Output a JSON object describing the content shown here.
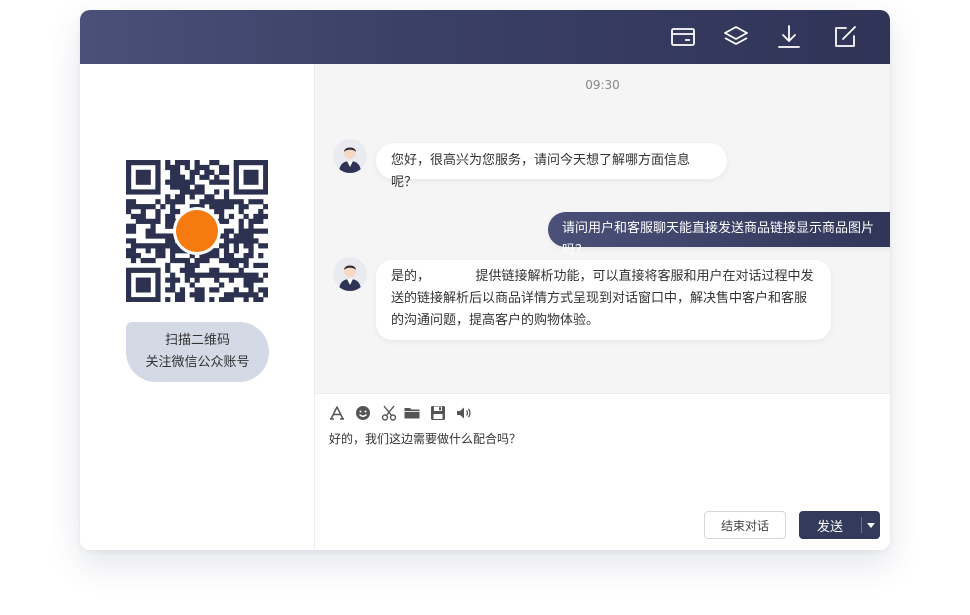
{
  "titlebar": {
    "icons": [
      "card-icon",
      "layers-icon",
      "download-icon",
      "edit-icon"
    ]
  },
  "left_panel": {
    "qr_caption_line1": "扫描二维码",
    "qr_caption_line2": "关注微信公众账号"
  },
  "chat": {
    "time": "09:30",
    "messages": [
      {
        "sender": "agent",
        "text": "您好，很高兴为您服务，请问今天想了解哪方面信息呢？"
      },
      {
        "sender": "user",
        "text": "请问用户和客服聊天能直接发送商品链接显示商品图片吗？"
      },
      {
        "sender": "agent",
        "text_line1": "是的，　　　　提供链接解析功能，可以直接将客服和用户在对话过程中发",
        "text_line2": "送的链接解析后以商品详情方式呈现到对话窗口中，解决售中客户和客服",
        "text_line3": "的沟通问题，提高客户的购物体验。"
      }
    ]
  },
  "toolbar": {
    "icons": [
      "font-icon",
      "emoji-icon",
      "scissors-icon",
      "folder-icon",
      "save-icon",
      "volume-icon"
    ]
  },
  "input": {
    "value": "好的，我们这边需要做什么配合吗？"
  },
  "buttons": {
    "end_label": "结束对话",
    "send_label": "发送"
  },
  "colors": {
    "titlebar": "#3b4066",
    "accent": "#333a5c",
    "qr_center": "#f57a10",
    "caption_bg": "#d3d9e5"
  }
}
